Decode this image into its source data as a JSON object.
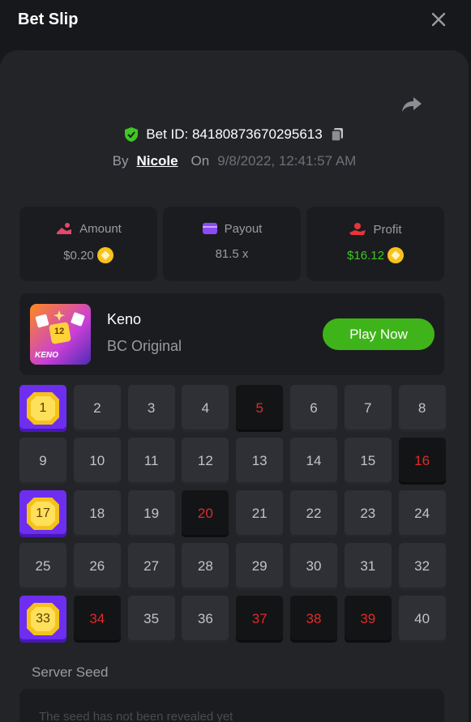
{
  "header": {
    "title": "Bet Slip"
  },
  "bet": {
    "id_text": "Bet ID: 84180873670295613",
    "by_label": "By",
    "user": "Nicole",
    "on_label": "On",
    "date": "9/8/2022, 12:41:57 AM"
  },
  "stats": {
    "amount": {
      "label": "Amount",
      "value": "$0.20"
    },
    "payout": {
      "label": "Payout",
      "value": "81.5 x"
    },
    "profit": {
      "label": "Profit",
      "value": "$16.12"
    }
  },
  "game": {
    "thumb_text": "KENO",
    "thumb_tile": "12",
    "name": "Keno",
    "subtitle": "BC Original",
    "play_label": "Play Now"
  },
  "grid": {
    "cells": [
      {
        "n": "1",
        "s": "hit"
      },
      {
        "n": "2",
        "s": "none"
      },
      {
        "n": "3",
        "s": "none"
      },
      {
        "n": "4",
        "s": "none"
      },
      {
        "n": "5",
        "s": "miss"
      },
      {
        "n": "6",
        "s": "none"
      },
      {
        "n": "7",
        "s": "none"
      },
      {
        "n": "8",
        "s": "none"
      },
      {
        "n": "9",
        "s": "none"
      },
      {
        "n": "10",
        "s": "none"
      },
      {
        "n": "11",
        "s": "none"
      },
      {
        "n": "12",
        "s": "none"
      },
      {
        "n": "13",
        "s": "none"
      },
      {
        "n": "14",
        "s": "none"
      },
      {
        "n": "15",
        "s": "none"
      },
      {
        "n": "16",
        "s": "miss"
      },
      {
        "n": "17",
        "s": "hit"
      },
      {
        "n": "18",
        "s": "none"
      },
      {
        "n": "19",
        "s": "none"
      },
      {
        "n": "20",
        "s": "miss"
      },
      {
        "n": "21",
        "s": "none"
      },
      {
        "n": "22",
        "s": "none"
      },
      {
        "n": "23",
        "s": "none"
      },
      {
        "n": "24",
        "s": "none"
      },
      {
        "n": "25",
        "s": "none"
      },
      {
        "n": "26",
        "s": "none"
      },
      {
        "n": "27",
        "s": "none"
      },
      {
        "n": "28",
        "s": "none"
      },
      {
        "n": "29",
        "s": "none"
      },
      {
        "n": "30",
        "s": "none"
      },
      {
        "n": "31",
        "s": "none"
      },
      {
        "n": "32",
        "s": "none"
      },
      {
        "n": "33",
        "s": "hit"
      },
      {
        "n": "34",
        "s": "miss"
      },
      {
        "n": "35",
        "s": "none"
      },
      {
        "n": "36",
        "s": "none"
      },
      {
        "n": "37",
        "s": "miss"
      },
      {
        "n": "38",
        "s": "miss"
      },
      {
        "n": "39",
        "s": "miss"
      },
      {
        "n": "40",
        "s": "none"
      }
    ]
  },
  "seed": {
    "label": "Server Seed",
    "value": "The seed has not been revealed yet"
  },
  "icons": {
    "close": "close-icon",
    "share": "share-icon",
    "verified": "shield-check-icon",
    "copy": "copy-icon",
    "amount": "coins-hand-icon",
    "payout": "wallet-icon",
    "profit": "profit-hand-icon",
    "currency": "bcd-coin-icon"
  },
  "colors": {
    "accent_green": "#3fb41a",
    "profit_green": "#3fc723",
    "miss_red": "#e02b2b",
    "hit_purple": "#6d2ef0",
    "gem_gold": "#f4c21a"
  }
}
